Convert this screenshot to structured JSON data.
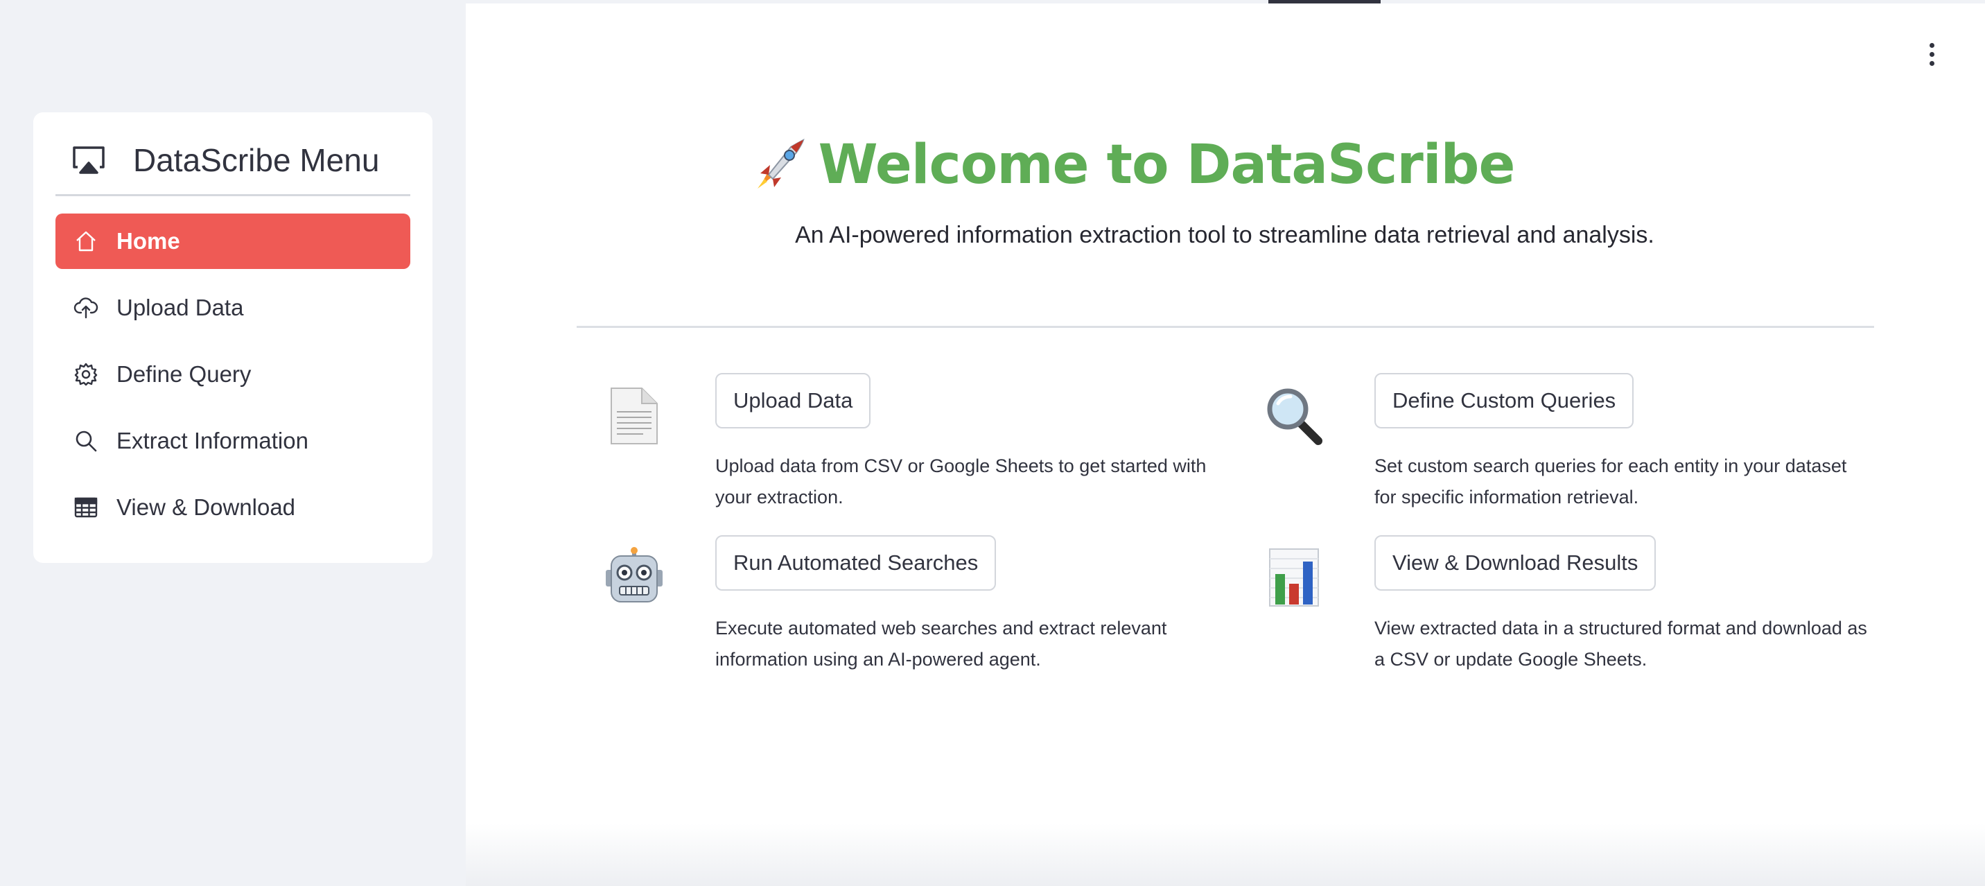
{
  "sidebar": {
    "title": "DataScribe Menu",
    "title_icon": "airplay-icon",
    "items": [
      {
        "label": "Home",
        "icon": "house-icon",
        "active": true
      },
      {
        "label": "Upload Data",
        "icon": "cloud-upload-icon",
        "active": false
      },
      {
        "label": "Define Query",
        "icon": "gear-icon",
        "active": false
      },
      {
        "label": "Extract Information",
        "icon": "search-icon",
        "active": false
      },
      {
        "label": "View & Download",
        "icon": "table-icon",
        "active": false
      }
    ],
    "active_color": "#ef5a55"
  },
  "main": {
    "title": "Welcome to DataScribe",
    "title_icon": "rocket-icon",
    "title_color": "#5fad56",
    "subtitle": "An AI-powered information extraction tool to streamline data retrieval and analysis.",
    "menu_icon": "kebab-menu-icon",
    "features": [
      {
        "icon": "document-icon",
        "button": "Upload Data",
        "description": "Upload data from CSV or Google Sheets to get started with your extraction."
      },
      {
        "icon": "magnifier-icon",
        "button": "Define Custom Queries",
        "description": "Set custom search queries for each entity in your dataset for specific information retrieval."
      },
      {
        "icon": "robot-icon",
        "button": "Run Automated Searches",
        "description": "Execute automated web searches and extract relevant information using an AI-powered agent."
      },
      {
        "icon": "bar-chart-icon",
        "button": "View & Download Results",
        "description": "View extracted data in a structured format and download as a CSV or update Google Sheets."
      }
    ]
  }
}
